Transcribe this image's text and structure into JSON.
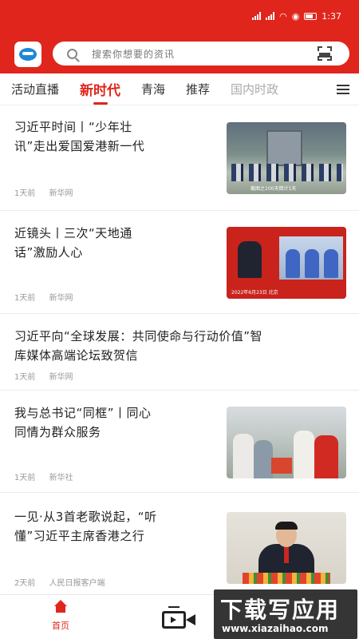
{
  "status_bar": {
    "time": "1:37"
  },
  "search": {
    "placeholder": "搜索你想要的资讯"
  },
  "tabs": [
    {
      "label": "活动直播"
    },
    {
      "label": "新时代",
      "active": true
    },
    {
      "label": "青海"
    },
    {
      "label": "推荐"
    },
    {
      "label": "国内时政"
    }
  ],
  "feed": [
    {
      "title_lines": [
        "习近平时间丨“少年壮",
        "讯”走出爱国爱港新一代"
      ],
      "time": "1天前",
      "source": "新华网",
      "image_caption": "截图之100天倒计1天"
    },
    {
      "title_lines": [
        "近镜头丨三次“天地通",
        "话”激励人心"
      ],
      "time": "1天前",
      "source": "新华网",
      "image_caption": "2022年6月23日 北京"
    },
    {
      "title_lines": [
        "习近平向“全球发展：共同使命与行动价值”智",
        "库媒体高端论坛致贺信"
      ],
      "time": "1天前",
      "source": "新华网"
    },
    {
      "title_lines": [
        "我与总书记“同框”丨同心",
        "同情为群众服务"
      ],
      "time": "1天前",
      "source": "新华社"
    },
    {
      "title_lines": [
        "一见·从3首老歌说起，“听",
        "懂”习近平主席香港之行"
      ],
      "time": "2天前",
      "source": "人民日报客户端"
    }
  ],
  "bottom_nav": {
    "home_label": "首页"
  },
  "watermark": {
    "title": "下载写应用",
    "url": "www.xiazaihao.com"
  },
  "colors": {
    "brand_red": "#e0261c"
  }
}
